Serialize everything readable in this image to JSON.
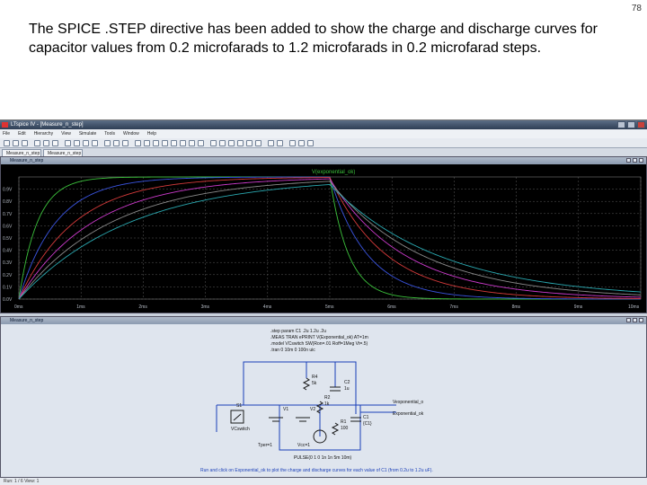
{
  "slide": {
    "number": "78",
    "caption": "The SPICE .STEP directive has been added to show the charge and discharge curves for  capacitor values from 0.2 microfarads to 1.2 microfarads in 0.2 microfarad steps."
  },
  "app": {
    "title": "LTspice IV - [Measure_n_step]",
    "menu": [
      "File",
      "Edit",
      "Hierarchy",
      "View",
      "Simulate",
      "Tools",
      "Window",
      "Help"
    ],
    "tabs": [
      "Measure_n_step",
      "Measure_n_step"
    ],
    "status": "Run: 1 / 6  View: 1"
  },
  "waveform": {
    "pane_title": "Measure_n_step",
    "trace_label": "V(exponential_ok)",
    "y_ticks": [
      "0.9V",
      "0.8V",
      "0.7V",
      "0.6V",
      "0.5V",
      "0.4V",
      "0.3V",
      "0.2V",
      "0.1V",
      "0.0V"
    ],
    "x_ticks": [
      "0ms",
      "1ms",
      "2ms",
      "3ms",
      "4ms",
      "5ms",
      "6ms",
      "7ms",
      "8ms",
      "9ms",
      "10ms"
    ],
    "colors": {
      "background": "#000000",
      "grid": "#5a5a5a",
      "axis_text": "#b8bec8"
    }
  },
  "chart_data": {
    "type": "line",
    "xlabel": "",
    "ylabel": "",
    "xlim": [
      0,
      10
    ],
    "ylim": [
      0,
      1
    ],
    "x_unit": "ms",
    "y_unit": "V",
    "pulse_low_to_high_ms": 0,
    "pulse_high_to_low_ms": 5,
    "series": [
      {
        "tau_ms": 0.3,
        "color": "#3cc23c"
      },
      {
        "tau_ms": 0.6,
        "color": "#3a54e0"
      },
      {
        "tau_ms": 0.9,
        "color": "#d43a3a"
      },
      {
        "tau_ms": 1.2,
        "color": "#cc3acc"
      },
      {
        "tau_ms": 1.5,
        "color": "#8a8a8a"
      },
      {
        "tau_ms": 1.8,
        "color": "#2aa8b0"
      }
    ]
  },
  "schematic": {
    "pane_title": "Measure_n_step",
    "directives": [
      ".step param C1 .2u 1.2u .2u",
      ".MEAS TRAN ePRINT V(Exponential_ok) AT=1m",
      ".model VCswitch SW(Ron=.01 Roff=1Meg Vt=.5)",
      ".tran 0 10m 0 100n uic"
    ],
    "labels": {
      "r_top": "R4",
      "r_top_val": "5k",
      "c_top": "C2",
      "c_top_val": "1u",
      "r_mid": "R2",
      "r_mid_val": "1k",
      "r_low": "R1",
      "r_low_val": "100",
      "c1": "C1",
      "c1_val": "{C1}",
      "s1": "S1",
      "s1_model": "VCswitch",
      "v1": "V1",
      "v1_val": "Tper=1",
      "v2": "V2",
      "v2_val": "Vcc=1",
      "pulse": "PULSE(0 1 0 1n 1n 5m 10m)",
      "out1": "Vexponential_o",
      "out2": "Exponential_ok"
    },
    "note": "Run and click on Exponential_ok to plot the charge and discharge curves for each value of C1 (from 0.2u to 1.2u uF)."
  }
}
